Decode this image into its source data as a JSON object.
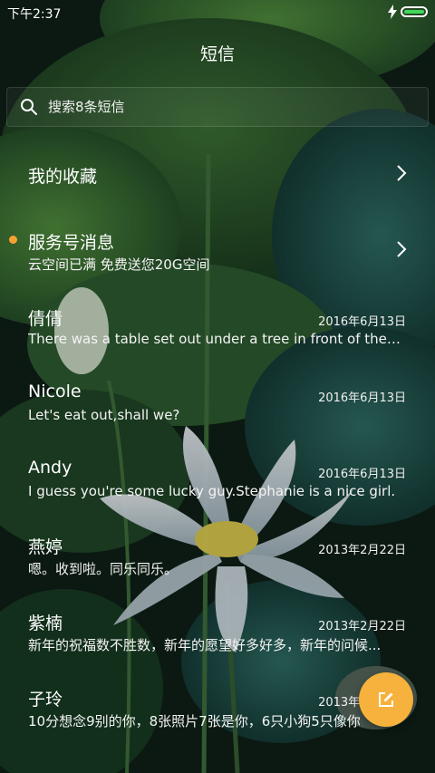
{
  "status": {
    "time": "下午2:37"
  },
  "header": {
    "title": "短信"
  },
  "search": {
    "placeholder": "搜索8条短信"
  },
  "folders": [
    {
      "title": "我的收藏"
    },
    {
      "title": "服务号消息",
      "preview": "云空间已满 免费送您20G空间",
      "unread": true
    }
  ],
  "conversations": [
    {
      "name": "倩倩",
      "date": "2016年6月13日",
      "preview": "There was a table set out under a tree in front of the ho..."
    },
    {
      "name": "Nicole",
      "date": "2016年6月13日",
      "preview": "Let's eat out,shall we?"
    },
    {
      "name": "Andy",
      "date": "2016年6月13日",
      "preview": "I guess you're some lucky guy.Stephanie is a nice girl."
    },
    {
      "name": "燕婷",
      "date": "2013年2月22日",
      "preview": "嗯。收到啦。同乐同乐。"
    },
    {
      "name": "紫楠",
      "date": "2013年2月22日",
      "preview": "新年的祝福数不胜数，新年的愿望好多好多，新年的问候..."
    },
    {
      "name": "子玲",
      "date": "2013年2月22日",
      "preview": "10分想念9别的你，8张照片7张是你，6只小狗5只像你"
    }
  ],
  "colors": {
    "accent": "#f6b23c",
    "unread_dot": "#f6a233",
    "battery": "#41d65a"
  }
}
